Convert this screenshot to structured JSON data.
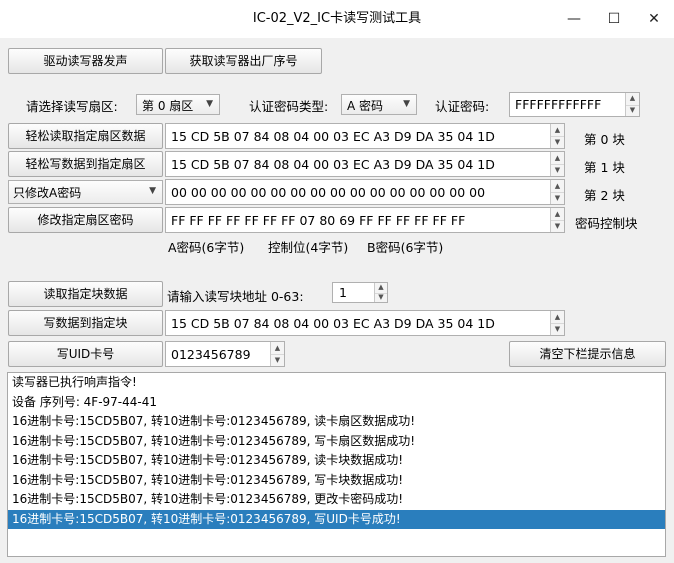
{
  "window": {
    "title": "IC-02_V2_IC卡读写测试工具",
    "minimize": "—",
    "maximize": "☐",
    "close": "✕"
  },
  "top_buttons": {
    "beep": "驱动读写器发声",
    "serial": "获取读写器出厂序号"
  },
  "config": {
    "sector_label": "请选择读写扇区:",
    "sector_value": "第 0 扇区",
    "keytype_label": "认证密码类型:",
    "keytype_value": "A 密码",
    "password_label": "认证密码:",
    "password_value": "FFFFFFFFFFFF"
  },
  "sector_rows": [
    {
      "button": "轻松读取指定扇区数据",
      "value": "15 CD 5B 07 84 08 04 00 03 EC A3 D9 DA 35 04 1D",
      "block": "第 0 块"
    },
    {
      "button": "轻松写数据到指定扇区",
      "value": "15 CD 5B 07 84 08 04 00 03 EC A3 D9 DA 35 04 1D",
      "block": "第 1 块"
    },
    {
      "button": "只修改A密码",
      "value": "00 00 00 00 00 00 00 00 00 00 00 00 00 00 00 00",
      "block": "第 2 块"
    },
    {
      "button": "修改指定扇区密码",
      "value": "FF FF FF FF FF FF FF 07 80 69 FF FF FF FF FF FF",
      "block": "密码控制块"
    }
  ],
  "key_legend": {
    "a": "A密码(6字节)",
    "ctrl": "控制位(4字节)",
    "b": "B密码(6字节)"
  },
  "block_ops": {
    "read_button": "读取指定块数据",
    "addr_label": "请输入读写块地址 0-63:",
    "addr_value": "1",
    "write_button": "写数据到指定块",
    "write_value": "15 CD 5B 07 84 08 04 00 03 EC A3 D9 DA 35 04 1D"
  },
  "uid": {
    "button": "写UID卡号",
    "value": "0123456789",
    "clear_button": "清空下栏提示信息"
  },
  "log": [
    "读写器已执行响声指令!",
    "设备 序列号:   4F-97-44-41",
    "16进制卡号:15CD5B07, 转10进制卡号:0123456789, 读卡扇区数据成功!",
    "16进制卡号:15CD5B07, 转10进制卡号:0123456789, 写卡扇区数据成功!",
    "16进制卡号:15CD5B07, 转10进制卡号:0123456789, 读卡块数据成功!",
    "16进制卡号:15CD5B07, 转10进制卡号:0123456789, 写卡块数据成功!",
    "16进制卡号:15CD5B07, 转10进制卡号:0123456789, 更改卡密码成功!",
    "16进制卡号:15CD5B07, 转10进制卡号:0123456789, 写UID卡号成功!"
  ],
  "log_selected_index": 7,
  "colors": {
    "selection": "#2a7ebd",
    "window_bg": "#f0f0f0"
  }
}
